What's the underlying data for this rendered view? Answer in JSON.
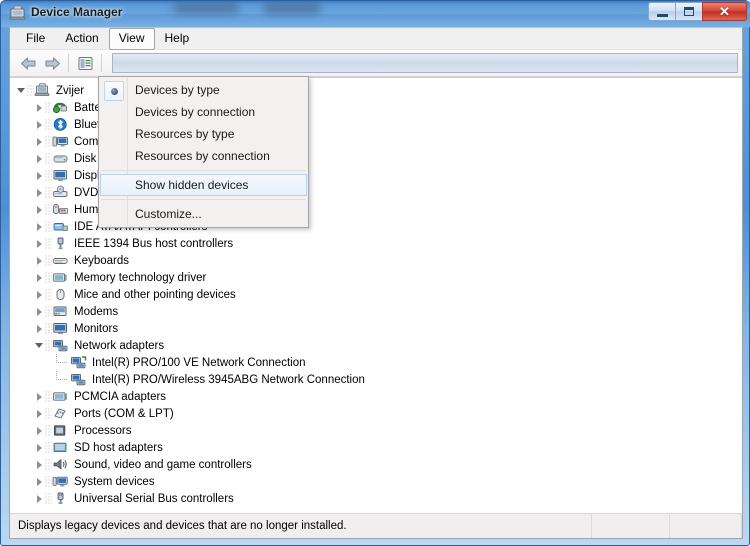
{
  "window": {
    "title": "Device Manager",
    "icon": "device-manager-icon",
    "controls": {
      "minimize": "Minimize",
      "maximize": "Maximize",
      "close": "Close",
      "close_glyph": "✕"
    }
  },
  "menubar": {
    "items": [
      {
        "label": "File",
        "active": false
      },
      {
        "label": "Action",
        "active": false
      },
      {
        "label": "View",
        "active": true
      },
      {
        "label": "Help",
        "active": false
      }
    ]
  },
  "toolbar": {
    "buttons": [
      {
        "name": "back-button",
        "icon": "back-arrow-icon"
      },
      {
        "name": "forward-button",
        "icon": "forward-arrow-icon"
      },
      {
        "name": "properties-button",
        "icon": "properties-icon"
      }
    ]
  },
  "view_menu": {
    "items": [
      {
        "label": "Devices by type",
        "radio": true,
        "checked": true,
        "highlight": false
      },
      {
        "label": "Devices by connection",
        "radio": false,
        "checked": false,
        "highlight": false
      },
      {
        "label": "Resources by type",
        "radio": false,
        "checked": false,
        "highlight": false
      },
      {
        "label": "Resources by connection",
        "radio": false,
        "checked": false,
        "highlight": false
      },
      {
        "label": "Show hidden devices",
        "radio": false,
        "checked": false,
        "highlight": true
      },
      {
        "label": "Customize...",
        "radio": false,
        "checked": false,
        "highlight": false
      }
    ]
  },
  "tree": {
    "root": {
      "label": "Zvijer",
      "icon": "computer-icon",
      "state": "expanded"
    },
    "nodes": [
      {
        "label": "Batteries",
        "icon": "battery-icon",
        "state": "collapsed",
        "level": 1
      },
      {
        "label": "Bluetooth Radios",
        "icon": "bluetooth-icon",
        "state": "collapsed",
        "level": 1
      },
      {
        "label": "Computer",
        "icon": "computer-node-icon",
        "state": "collapsed",
        "level": 1
      },
      {
        "label": "Disk drives",
        "icon": "disk-drive-icon",
        "state": "collapsed",
        "level": 1
      },
      {
        "label": "Display adapters",
        "icon": "display-adapter-icon",
        "state": "collapsed",
        "level": 1
      },
      {
        "label": "DVD/CD-ROM drives",
        "icon": "dvd-drive-icon",
        "state": "collapsed",
        "level": 1
      },
      {
        "label": "Human Interface Devices",
        "icon": "hid-icon",
        "state": "collapsed",
        "level": 1
      },
      {
        "label": "IDE ATA/ATAPI controllers",
        "icon": "ide-controller-icon",
        "state": "collapsed",
        "level": 1
      },
      {
        "label": "IEEE 1394 Bus host controllers",
        "icon": "ieee1394-icon",
        "state": "collapsed",
        "level": 1
      },
      {
        "label": "Keyboards",
        "icon": "keyboard-icon",
        "state": "collapsed",
        "level": 1
      },
      {
        "label": "Memory technology driver",
        "icon": "memory-icon",
        "state": "collapsed",
        "level": 1
      },
      {
        "label": "Mice and other pointing devices",
        "icon": "mouse-icon",
        "state": "collapsed",
        "level": 1
      },
      {
        "label": "Modems",
        "icon": "modem-icon",
        "state": "collapsed",
        "level": 1
      },
      {
        "label": "Monitors",
        "icon": "monitor-icon",
        "state": "collapsed",
        "level": 1
      },
      {
        "label": "Network adapters",
        "icon": "network-adapter-icon",
        "state": "expanded",
        "level": 1
      },
      {
        "label": "Intel(R) PRO/100 VE Network Connection",
        "icon": "network-device-icon",
        "state": "leaf",
        "level": 2
      },
      {
        "label": "Intel(R) PRO/Wireless 3945ABG Network Connection",
        "icon": "network-device-icon",
        "state": "leaf",
        "level": 2
      },
      {
        "label": "PCMCIA adapters",
        "icon": "pcmcia-icon",
        "state": "collapsed",
        "level": 1
      },
      {
        "label": "Ports (COM & LPT)",
        "icon": "port-icon",
        "state": "collapsed",
        "level": 1
      },
      {
        "label": "Processors",
        "icon": "processor-icon",
        "state": "collapsed",
        "level": 1
      },
      {
        "label": "SD host adapters",
        "icon": "sd-adapter-icon",
        "state": "collapsed",
        "level": 1
      },
      {
        "label": "Sound, video and game controllers",
        "icon": "sound-icon",
        "state": "collapsed",
        "level": 1
      },
      {
        "label": "System devices",
        "icon": "system-device-icon",
        "state": "collapsed",
        "level": 1
      },
      {
        "label": "Universal Serial Bus controllers",
        "icon": "usb-icon",
        "state": "collapsed",
        "level": 1
      }
    ]
  },
  "statusbar": {
    "message": "Displays legacy devices and devices that are no longer installed."
  },
  "colors": {
    "titlebar_blue": "#5b9ad8",
    "close_red": "#d9453a",
    "menu_highlight": "#e8f0fa",
    "menu_highlight_border": "#b6d2ef",
    "tree_bg": "#ffffff",
    "chrome_bg": "#f0f0f0"
  }
}
